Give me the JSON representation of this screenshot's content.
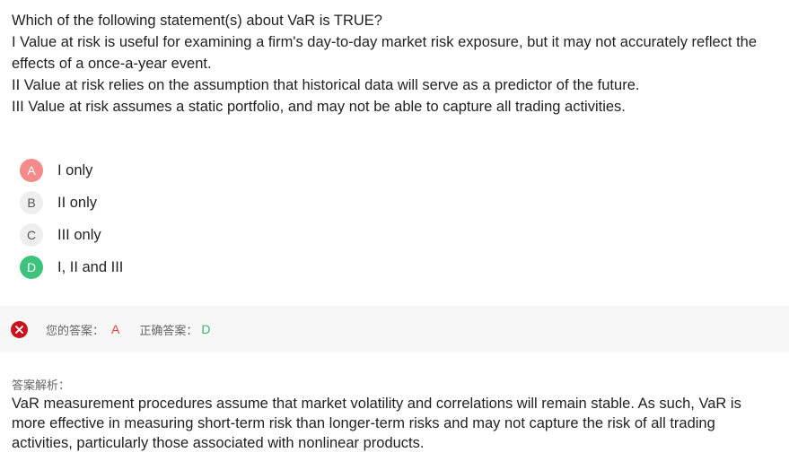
{
  "question": {
    "stem": "Which of the following statement(s) about VaR is TRUE?",
    "statements": [
      "I Value at risk is useful for examining a firm's day-to-day market risk exposure, but it may not accurately reflect the effects of a once-a-year event.",
      "II Value at risk relies on the assumption that historical data will serve as a predictor of the future.",
      "III Value at risk assumes a static portfolio, and may not be able to capture all trading activities."
    ]
  },
  "options": [
    {
      "letter": "A",
      "text": "I only",
      "state": "wrong"
    },
    {
      "letter": "B",
      "text": "II only",
      "state": "normal"
    },
    {
      "letter": "C",
      "text": "III only",
      "state": "normal"
    },
    {
      "letter": "D",
      "text": "I, II and III",
      "state": "right"
    }
  ],
  "result": {
    "icon": "x-circle-icon",
    "your_answer_label": "您的答案：",
    "your_answer": "A",
    "correct_answer_label": "正确答案：",
    "correct_answer": "D"
  },
  "explanation": {
    "label": "答案解析：",
    "text": "VaR measurement procedures assume that market volatility and correlations will remain stable. As such, VaR is more effective in measuring short-term risk than longer-term risks and may not capture the risk of all trading activities, particularly those associated with nonlinear products."
  },
  "colors": {
    "wrong": "#f48a8a",
    "right": "#3cc47c",
    "error_icon": "#c8141e",
    "your_answer_text": "#e0403f",
    "correct_answer_text": "#3cb371"
  }
}
